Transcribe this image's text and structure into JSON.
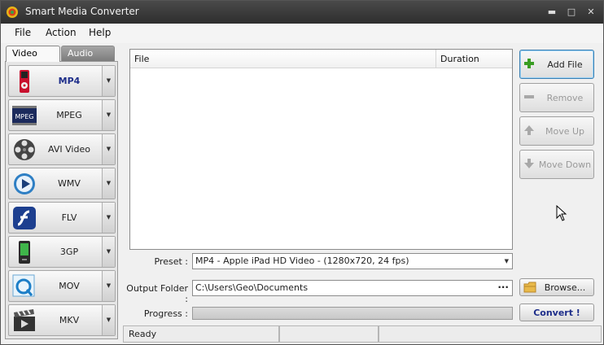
{
  "window": {
    "title": "Smart Media Converter"
  },
  "menu": {
    "items": [
      "File",
      "Action",
      "Help"
    ]
  },
  "tabs": [
    {
      "label": "Video",
      "active": true
    },
    {
      "label": "Audio",
      "active": false
    }
  ],
  "formats": [
    {
      "label": "MP4",
      "icon": "ipod-icon",
      "active": true
    },
    {
      "label": "MPEG",
      "icon": "mpeg-film-icon",
      "badge": "MPEG",
      "active": false
    },
    {
      "label": "AVI Video",
      "icon": "film-reel-icon",
      "active": false
    },
    {
      "label": "WMV",
      "icon": "media-player-icon",
      "active": false
    },
    {
      "label": "FLV",
      "icon": "flash-icon",
      "active": false
    },
    {
      "label": "3GP",
      "icon": "mobile-phone-icon",
      "active": false
    },
    {
      "label": "MOV",
      "icon": "quicktime-icon",
      "active": false
    },
    {
      "label": "MKV",
      "icon": "clapperboard-icon",
      "active": false
    }
  ],
  "file_list": {
    "columns": [
      "File",
      "Duration"
    ],
    "rows": []
  },
  "buttons": {
    "add_file": "Add File",
    "remove": "Remove",
    "move_up": "Move Up",
    "move_down": "Move Down",
    "browse": "Browse...",
    "convert": "Convert !"
  },
  "form": {
    "preset_label": "Preset :",
    "preset_value": "MP4 - Apple iPad HD Video - (1280x720, 24 fps)",
    "output_label": "Output Folder :",
    "output_value": "C:\\Users\\Geo\\Documents",
    "output_browse_glyph": "···",
    "progress_label": "Progress :",
    "progress_value": 0
  },
  "status": {
    "text": "Ready"
  },
  "colors": {
    "accent_blue": "#1e2e8a",
    "titlebar": "#363636",
    "primary_border": "#3c7fb1"
  }
}
